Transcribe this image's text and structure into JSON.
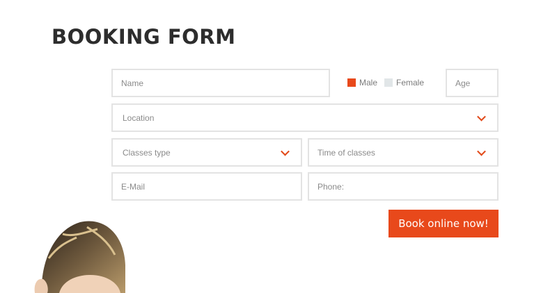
{
  "title": "BOOKING FORM",
  "fields": {
    "name_placeholder": "Name",
    "age_placeholder": "Age",
    "location_placeholder": "Location",
    "classes_type_placeholder": "Classes type",
    "time_of_classes_placeholder": "Time of classes",
    "email_placeholder": "E-Mail",
    "phone_placeholder": "Phone:"
  },
  "gender": {
    "male_label": "Male",
    "female_label": "Female",
    "selected": "Male"
  },
  "submit_label": "Book online now!",
  "colors": {
    "accent": "#e8491b",
    "border": "#e3e3e3",
    "unselected": "#e1e6e8"
  },
  "icons": {
    "dropdown": "chevron-down-icon"
  }
}
